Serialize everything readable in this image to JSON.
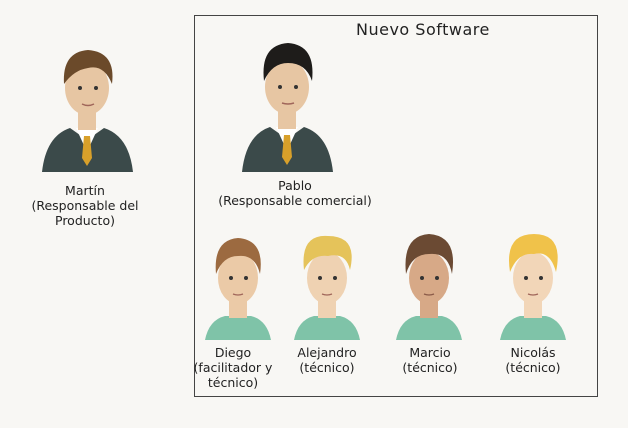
{
  "frame": {
    "title": "Nuevo Software"
  },
  "people": [
    {
      "id": "martin",
      "lines": [
        "Martín",
        "(Responsable del",
        "Producto)"
      ],
      "hair": "#6b4a2a",
      "skin": "#e7c6a3",
      "shirt": "#3b4a4a"
    },
    {
      "id": "pablo",
      "lines": [
        "Pablo",
        "(Responsable comercial)"
      ],
      "hair": "#1e1c1a",
      "skin": "#e7c6a3",
      "shirt": "#3b4a4a"
    },
    {
      "id": "diego",
      "lines": [
        "Diego",
        "(facilitador y",
        "técnico)"
      ],
      "hair": "#9c6a40",
      "skin": "#ebcaa7",
      "shirt": "#7fc3a8"
    },
    {
      "id": "alejandro",
      "lines": [
        "Alejandro",
        "(técnico)"
      ],
      "hair": "#e5c35a",
      "skin": "#efd2b2",
      "shirt": "#7fc3a8"
    },
    {
      "id": "marcio",
      "lines": [
        "Marcio",
        "(técnico)"
      ],
      "hair": "#6b4a33",
      "skin": "#d7a987",
      "shirt": "#7fc3a8"
    },
    {
      "id": "nicolas",
      "lines": [
        "Nicolás",
        "(técnico)"
      ],
      "hair": "#f0c24a",
      "skin": "#f2d6b8",
      "shirt": "#7fc3a8"
    }
  ]
}
